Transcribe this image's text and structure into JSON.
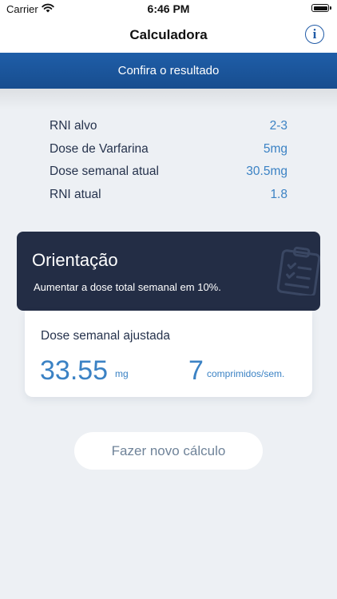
{
  "status_bar": {
    "carrier": "Carrier",
    "time": "6:46 PM"
  },
  "nav": {
    "title": "Calculadora",
    "info_glyph": "i"
  },
  "banner": {
    "text": "Confira o resultado"
  },
  "results": [
    {
      "label": "RNI alvo",
      "value": "2-3"
    },
    {
      "label": "Dose de Varfarina",
      "value": "5mg"
    },
    {
      "label": "Dose semanal atual",
      "value": "30.5mg"
    },
    {
      "label": "RNI atual",
      "value": "1.8"
    }
  ],
  "orientation": {
    "title": "Orientação",
    "text": "Aumentar a dose total semanal em 10%."
  },
  "dose": {
    "heading": "Dose semanal ajustada",
    "value": "33.55",
    "unit": "mg",
    "pills": "7",
    "pills_unit": "comprimidos/sem."
  },
  "actions": {
    "recalculate_label": "Fazer novo cálculo"
  },
  "colors": {
    "primary_blue": "#1f5ea8",
    "accent_value": "#3b82c4",
    "dark_card": "#232d45",
    "background": "#edf0f4"
  }
}
